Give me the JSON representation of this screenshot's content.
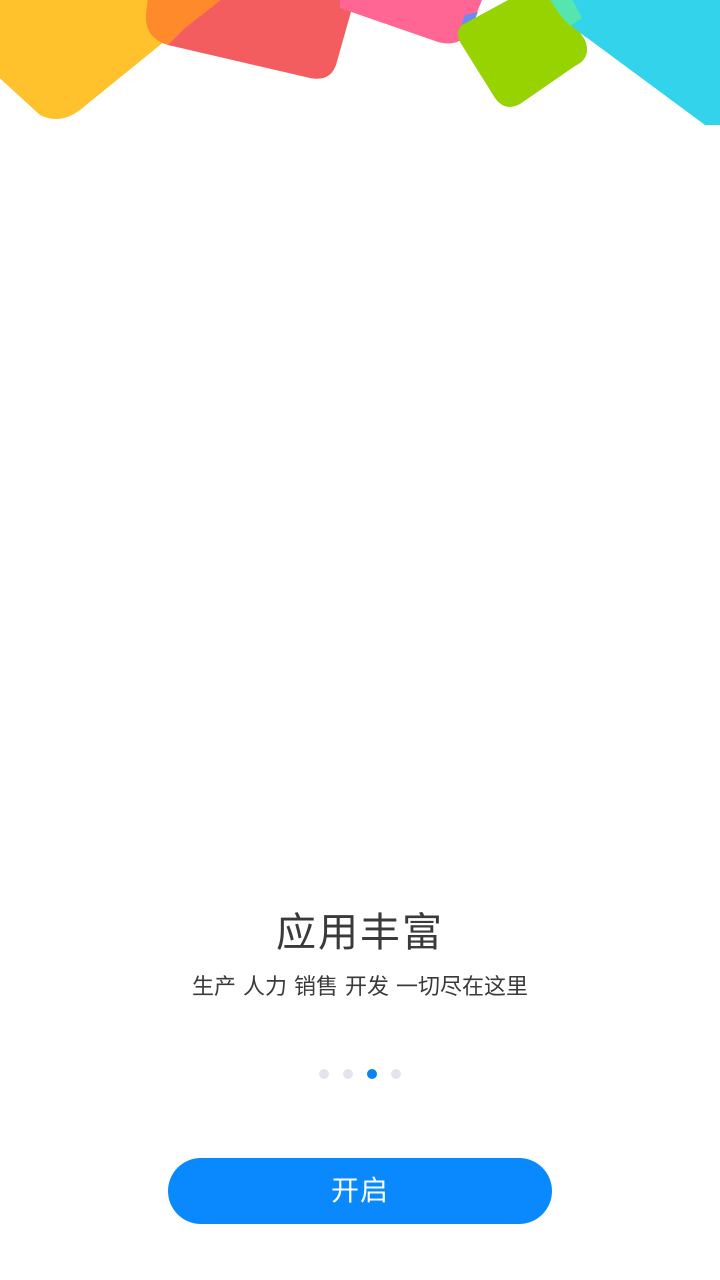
{
  "onboarding": {
    "title": "应用丰富",
    "subtitle": "生产 人力 销售 开发 一切尽在这里",
    "page_indicator": {
      "total": 4,
      "current": 3
    },
    "start_button_label": "开启"
  },
  "colors": {
    "accent": "#0a89ff",
    "dot_active": "#0a84f0",
    "dot_inactive": "#e3e5ec",
    "text": "#3a3a3a",
    "shape_yellow": "#ffc22c",
    "shape_orange": "#ff8a2b",
    "shape_red": "#f45d5f",
    "shape_pink": "#ff6694",
    "shape_green": "#97d300",
    "shape_cyan": "#33d3eb"
  }
}
